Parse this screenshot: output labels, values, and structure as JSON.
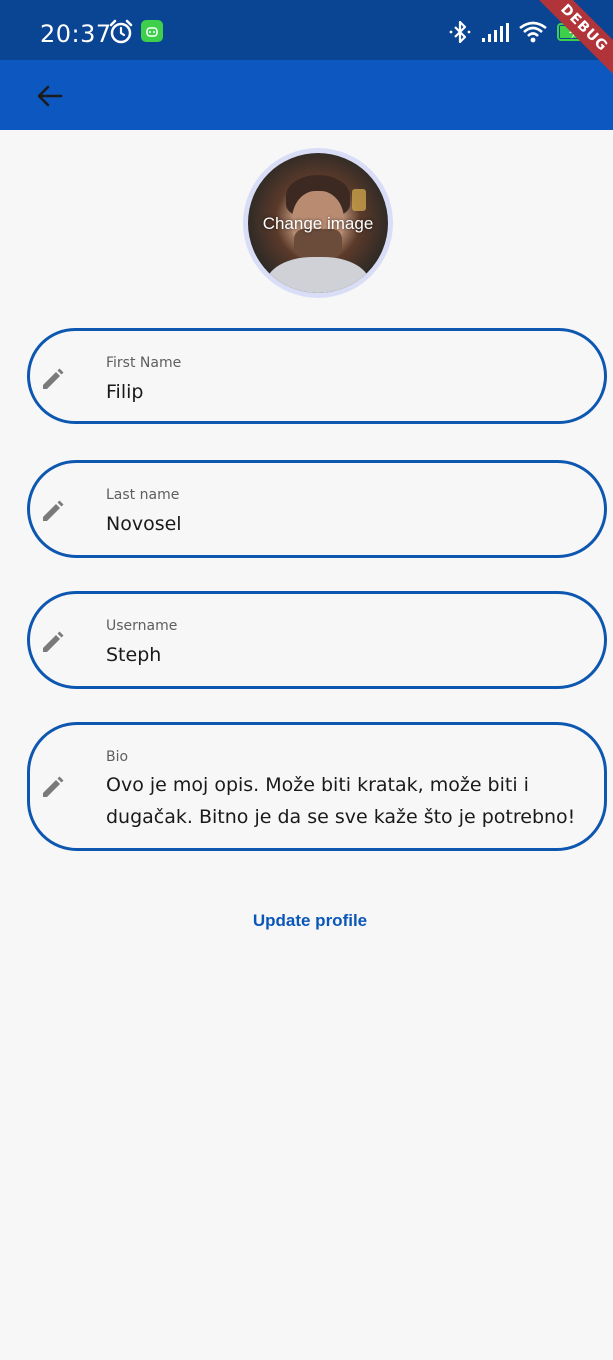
{
  "status_bar": {
    "time": "20:37",
    "icons": [
      "alarm-icon",
      "android-notification-icon",
      "bluetooth-icon",
      "signal-icon",
      "wifi-icon",
      "battery-charging-icon"
    ]
  },
  "debug_banner": "DEBUG",
  "app_bar": {
    "back_icon": "arrow-back-icon"
  },
  "profile_image": {
    "overlay_label": "Change image"
  },
  "fields": [
    {
      "label": "First Name",
      "value": "Filip",
      "icon": "edit-pencil-icon"
    },
    {
      "label": "Last name",
      "value": "Novosel",
      "icon": "edit-pencil-icon"
    },
    {
      "label": "Username",
      "value": "Steph",
      "icon": "edit-pencil-icon"
    },
    {
      "label": "Bio",
      "value": "Ovo je moj opis. Može biti kratak, može biti i dugačak. Bitno je da se sve kaže što je potrebno!",
      "icon": "edit-pencil-icon"
    }
  ],
  "actions": {
    "update_label": "Update profile"
  },
  "colors": {
    "status_bar": "#0a4593",
    "app_bar": "#0d57c0",
    "field_border": "#0d57b0",
    "accent_text": "#0b57b7",
    "background": "#f7f7f8"
  }
}
